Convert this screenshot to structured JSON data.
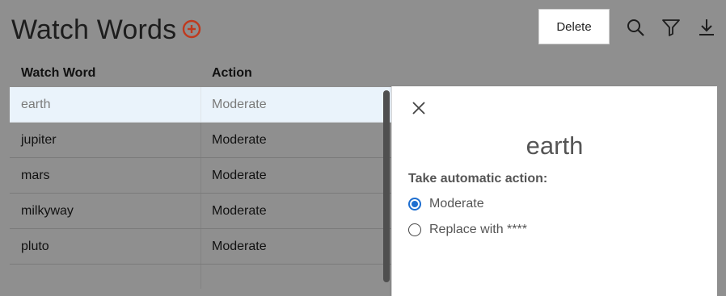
{
  "header": {
    "title": "Watch Words",
    "delete_label": "Delete"
  },
  "icons": {
    "add": "plus-circle-icon",
    "search": "search-icon",
    "filter": "filter-icon",
    "download": "download-icon",
    "close": "close-icon"
  },
  "colors": {
    "accent_red": "#c0391d",
    "radio_blue": "#1f6fd0",
    "selected_row": "#eaf3fb",
    "overlay_gray": "#8f8f8f"
  },
  "table": {
    "columns": [
      "Watch Word",
      "Action"
    ],
    "rows": [
      {
        "word": "earth",
        "action": "Moderate"
      },
      {
        "word": "jupiter",
        "action": "Moderate"
      },
      {
        "word": "mars",
        "action": "Moderate"
      },
      {
        "word": "milkyway",
        "action": "Moderate"
      },
      {
        "word": "pluto",
        "action": "Moderate"
      }
    ]
  },
  "panel": {
    "title": "earth",
    "action_label": "Take automatic action:",
    "options": [
      "Moderate",
      "Replace with ****"
    ],
    "selected_option": "Moderate"
  }
}
